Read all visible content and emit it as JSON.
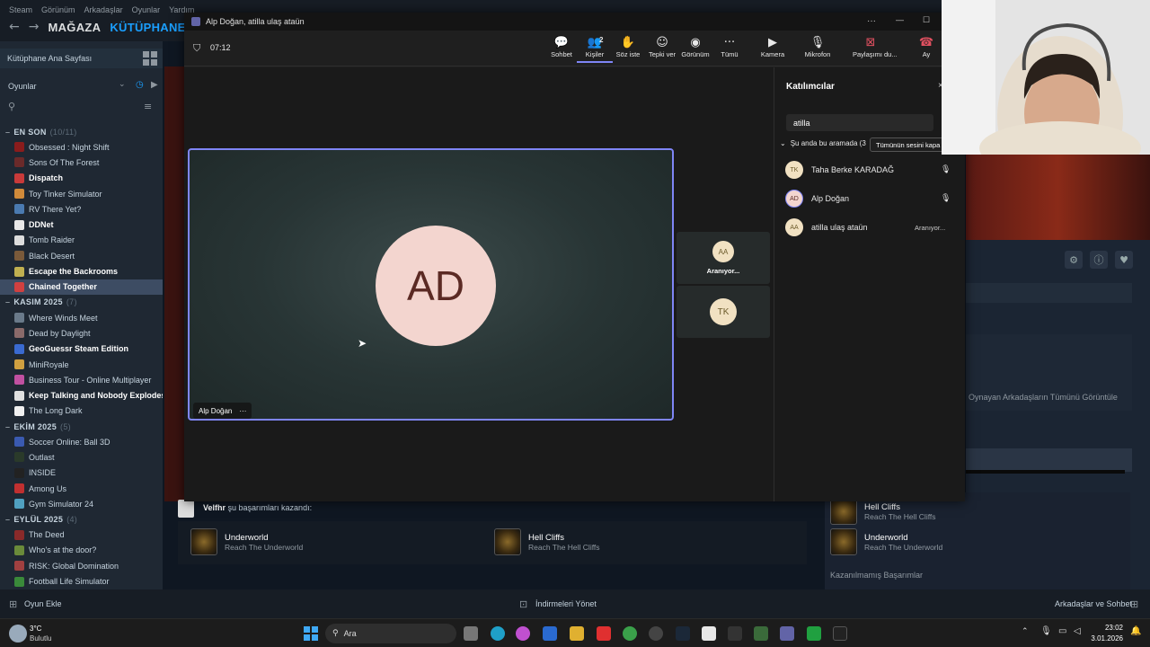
{
  "steam": {
    "menu": [
      "Steam",
      "Görünüm",
      "Arkadaşlar",
      "Oyunlar",
      "Yardım"
    ],
    "nav": {
      "store": "MAĞAZA",
      "library": "KÜTÜPHANE"
    },
    "library_home": "Kütüphane Ana Sayfası",
    "games_dropdown": "Oyunlar",
    "sections": [
      {
        "title": "EN SON",
        "count": "(10/11)",
        "games": [
          {
            "name": "Obsessed : Night Shift",
            "bold": false,
            "color": "#8a1c1c"
          },
          {
            "name": "Sons Of The Forest",
            "bold": false,
            "color": "#6a2a2a"
          },
          {
            "name": "Dispatch",
            "bold": true,
            "color": "#c83a3a"
          },
          {
            "name": "Toy Tinker Simulator",
            "bold": false,
            "color": "#d08a3a"
          },
          {
            "name": "RV There Yet?",
            "bold": false,
            "color": "#4a7ab0"
          },
          {
            "name": "DDNet",
            "bold": true,
            "color": "#e8e8e8"
          },
          {
            "name": "Tomb Raider",
            "bold": false,
            "color": "#dddddd"
          },
          {
            "name": "Black Desert",
            "bold": false,
            "color": "#7a5a3a"
          },
          {
            "name": "Escape the Backrooms",
            "bold": true,
            "color": "#c0b050"
          },
          {
            "name": "Chained Together",
            "bold": true,
            "color": "#d04040",
            "selected": true
          }
        ]
      },
      {
        "title": "KASIM 2025",
        "count": "(7)",
        "games": [
          {
            "name": "Where Winds Meet",
            "bold": false,
            "color": "#6a7a8a"
          },
          {
            "name": "Dead by Daylight",
            "bold": false,
            "color": "#8a6a6a"
          },
          {
            "name": "GeoGuessr Steam Edition",
            "bold": true,
            "color": "#3a6ad0"
          },
          {
            "name": "MiniRoyale",
            "bold": false,
            "color": "#d0a040"
          },
          {
            "name": "Business Tour - Online Multiplayer",
            "bold": false,
            "color": "#c050a0"
          },
          {
            "name": "Keep Talking and Nobody Explodes",
            "bold": true,
            "color": "#e0e0e0"
          },
          {
            "name": "The Long Dark",
            "bold": false,
            "color": "#f0f0f0"
          }
        ]
      },
      {
        "title": "EKİM 2025",
        "count": "(5)",
        "games": [
          {
            "name": "Soccer Online: Ball 3D",
            "bold": false,
            "color": "#3a5ab0"
          },
          {
            "name": "Outlast",
            "bold": false,
            "color": "#2a3a2a"
          },
          {
            "name": "INSIDE",
            "bold": false,
            "color": "#222222"
          },
          {
            "name": "Among Us",
            "bold": false,
            "color": "#c03030"
          },
          {
            "name": "Gym Simulator 24",
            "bold": false,
            "color": "#50a0c0"
          }
        ]
      },
      {
        "title": "EYLÜL 2025",
        "count": "(4)",
        "games": [
          {
            "name": "The Deed",
            "bold": false,
            "color": "#8a2a2a"
          },
          {
            "name": "Who's at the door?",
            "bold": false,
            "color": "#6a8a3a"
          },
          {
            "name": "RISK: Global Domination",
            "bold": false,
            "color": "#a04040"
          },
          {
            "name": "Football Life Simulator",
            "bold": false,
            "color": "#3a8a3a"
          }
        ]
      }
    ],
    "friend_activity": {
      "user": "Velfhr",
      "text": "şu başarımları kazandı:"
    },
    "achievements": [
      {
        "name": "Underworld",
        "desc": "Reach The Underworld"
      },
      {
        "name": "Hell Cliffs",
        "desc": "Reach The Hell Cliffs"
      }
    ],
    "view_all_friends": "Oynayan Arkadaşların Tümünü Görüntüle",
    "unearned": "Kazanılmamış Başarımlar",
    "bottom": {
      "add_game": "Oyun Ekle",
      "downloads": "İndirmeleri Yönet",
      "friends": "Arkadaşlar ve Sohbet"
    }
  },
  "teams": {
    "title": "Alp Doğan, atilla ulaş ataün",
    "timer": "07:12",
    "toolbar": [
      {
        "label": "Sohbet",
        "icon": "chat-icon",
        "glyph": "💬"
      },
      {
        "label": "Kişiler",
        "icon": "people-icon",
        "glyph": "👥",
        "badge": "2"
      },
      {
        "label": "Söz iste",
        "icon": "raise-hand-icon",
        "glyph": "✋"
      },
      {
        "label": "Tepki ver",
        "icon": "smile-icon",
        "glyph": "☺"
      },
      {
        "label": "Görünüm",
        "icon": "view-icon",
        "glyph": "◉"
      },
      {
        "label": "Tümü",
        "icon": "more-icon",
        "glyph": "···"
      },
      {
        "label": "Kamera",
        "icon": "camera-off-icon",
        "glyph": "▶"
      },
      {
        "label": "Mikrofon",
        "icon": "mic-icon",
        "glyph": "🎙"
      },
      {
        "label": "Paylaşımı du...",
        "icon": "share-stop-icon",
        "glyph": "⊠"
      },
      {
        "label": "Ay",
        "icon": "leave-icon",
        "glyph": "☎"
      }
    ],
    "main_tile": {
      "initials": "AD",
      "name": "Alp Doğan"
    },
    "side_tiles": [
      {
        "initials": "AA",
        "status": "Aranıyor..."
      },
      {
        "initials": "TK",
        "status": ""
      }
    ],
    "panel": {
      "title": "Katılımcılar",
      "search_value": "atilla",
      "in_call": "Şu anda bu aramada (3",
      "mute_all": "Tümünün sesini kapa",
      "participants": [
        {
          "initials": "TK",
          "name": "Taha Berke KARADAĞ",
          "status": "",
          "mic": true
        },
        {
          "initials": "AD",
          "name": "Alp Doğan",
          "status": "",
          "mic": true
        },
        {
          "initials": "AA",
          "name": "atilla ulaş ataün",
          "status": "Aranıyor...",
          "mic": false
        }
      ]
    }
  },
  "taskbar": {
    "weather": {
      "temp": "3°C",
      "desc": "Bulutlu"
    },
    "search": "Ara",
    "time": "23:02",
    "date": "3.01.2026"
  }
}
